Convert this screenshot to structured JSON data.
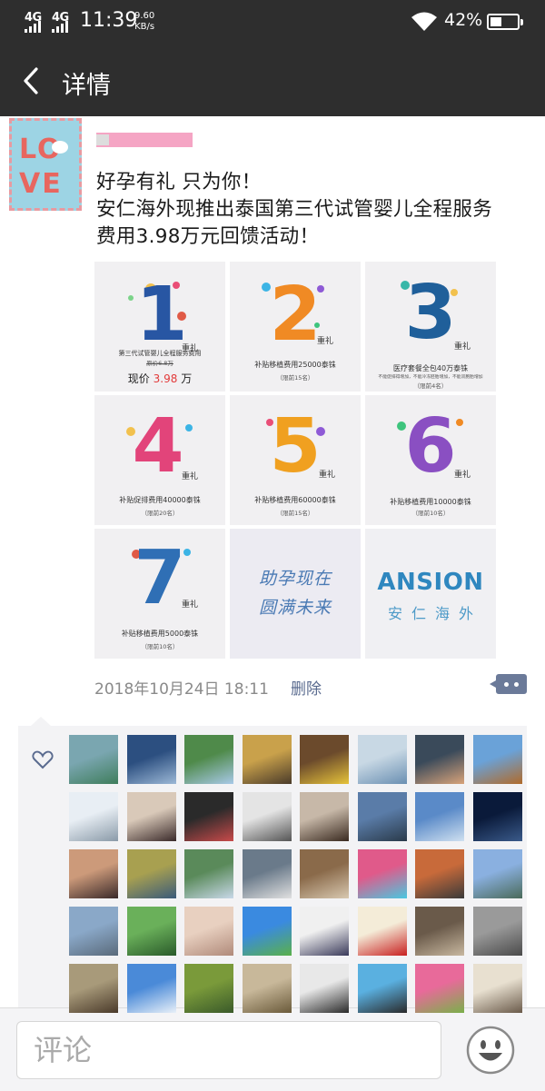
{
  "status_bar": {
    "net1": "4G",
    "net2": "4G",
    "time": "11:39",
    "speed_value": "9.60",
    "speed_unit": "KB/s",
    "battery_pct": "42%",
    "battery_level": 0.42
  },
  "nav": {
    "back_icon": "chevron-left-icon",
    "title": "详情"
  },
  "post": {
    "lines": [
      "好孕有礼 只为你！",
      "安仁海外现推出泰国第三代试管婴儿全程服务",
      "费用3.98万元回馈活动！"
    ],
    "time": "2018年10月24日  18:11",
    "delete": "删除",
    "tiles": [
      {
        "num": "1",
        "gift": "重礼",
        "caption": "第三代试管婴儿全程服务费用",
        "sub": "原价6.8万",
        "price_label": "现价",
        "price_value": "3.98",
        "price_unit": "万"
      },
      {
        "num": "2",
        "gift": "重礼",
        "caption": "补贴移植费用25000泰铢",
        "sub": "（限前15名）"
      },
      {
        "num": "3",
        "gift": "重礼",
        "caption": "医疗套餐全包40万泰铢",
        "sub": "不能促排得增加，不能冷冻胚胎增加，不能双胞胎增加",
        "sub2": "（限前4名）"
      },
      {
        "num": "4",
        "gift": "重礼",
        "caption": "补贴促排费用40000泰铢",
        "sub": "（限前20名）"
      },
      {
        "num": "5",
        "gift": "重礼",
        "caption": "补贴移植费用60000泰铢",
        "sub": "（限前15名）"
      },
      {
        "num": "6",
        "gift": "重礼",
        "caption": "补贴移植费用10000泰铢",
        "sub": "（限前10名）"
      },
      {
        "num": "7",
        "gift": "重礼",
        "caption": "补贴移植费用5000泰铢",
        "sub": "（限前10名）"
      },
      {
        "calligraphy1": "助孕现在",
        "calligraphy2": "圆满未来"
      },
      {
        "brand": "ANSION",
        "brand_cn": "安仁海外"
      }
    ]
  },
  "likes": {
    "heart_icon": "heart-outline-icon",
    "avatars": [
      "landscape-avatar",
      "sea-avatar",
      "mountain-avatar",
      "cartoon-girl-avatar",
      "yellow-figure-avatar",
      "anime-avatar",
      "man-glasses-avatar",
      "bear-avatar",
      "wedding-avatar",
      "woman-avatar",
      "flowers-avatar",
      "umbrella-avatar",
      "man-face-avatar",
      "anime-umbrella-avatar",
      "blue-sky-avatar",
      "night-sky-avatar",
      "woman-portrait-avatar",
      "field-avatar",
      "waterfall-avatar",
      "moon-avatar",
      "man-hat-avatar",
      "colorful-road-avatar",
      "bird-art-avatar",
      "city-avatar",
      "harbor-avatar",
      "leaf-avatar",
      "baby-avatar",
      "meadow-avatar",
      "suit-man-avatar",
      "wu-seal-avatar",
      "man-outdoor-avatar",
      "street-avatar",
      "clock-avatar",
      "ocean-avatar",
      "grass-avatar",
      "sparrow-avatar",
      "group-avatar",
      "jump-avatar",
      "lotus-avatar",
      "calligraphy-avatar"
    ]
  },
  "bottom": {
    "comment_placeholder": "评论",
    "emoji_icon": "smiley-face-icon"
  }
}
